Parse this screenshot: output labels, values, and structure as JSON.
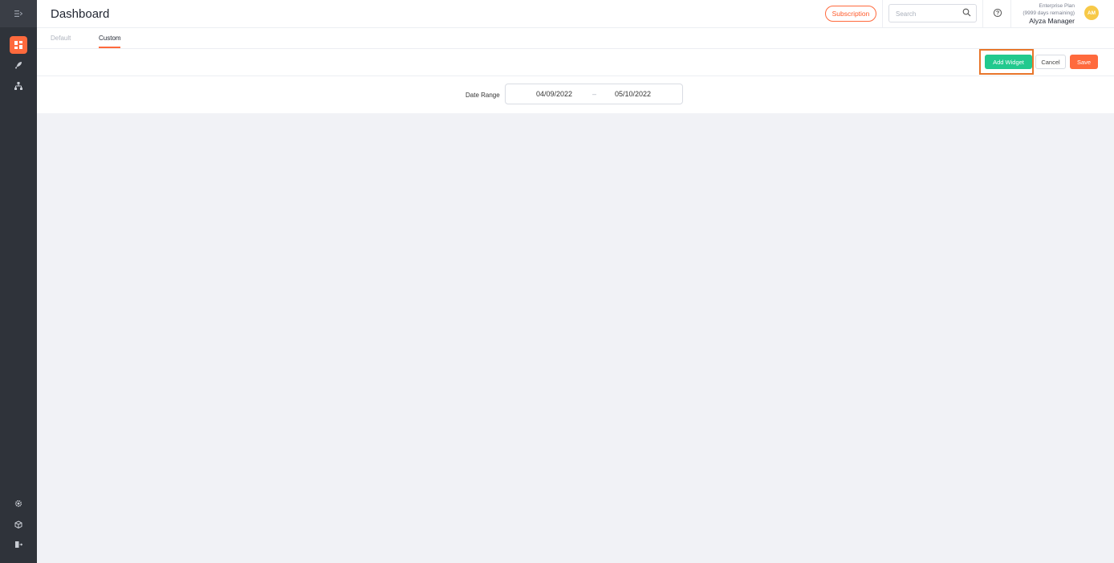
{
  "header": {
    "title": "Dashboard",
    "subscription_label": "Subscription",
    "search_placeholder": "Search",
    "plan_name": "Enterprise Plan",
    "plan_remaining": "(9999 days remaining)",
    "user_name": "Alyza Manager",
    "avatar_initials": "AM"
  },
  "tabs": [
    {
      "label": "Default",
      "active": false
    },
    {
      "label": "Custom",
      "active": true
    }
  ],
  "toolbar": {
    "add_widget_label": "Add Widget",
    "cancel_label": "Cancel",
    "save_label": "Save"
  },
  "date_range": {
    "label": "Date Range",
    "from": "04/09/2022",
    "separator": "–",
    "to": "05/10/2022"
  },
  "sidebar": {
    "top_icons": [
      "dashboard-icon",
      "rocket-icon",
      "org-chart-icon"
    ],
    "bottom_icons": [
      "gear-icon",
      "cube-icon",
      "logout-icon"
    ]
  },
  "colors": {
    "accent": "#ff6a3d",
    "add_widget": "#22c98e",
    "highlight": "#e8762b",
    "sidebar": "#2f333a",
    "avatar": "#f7c948"
  }
}
